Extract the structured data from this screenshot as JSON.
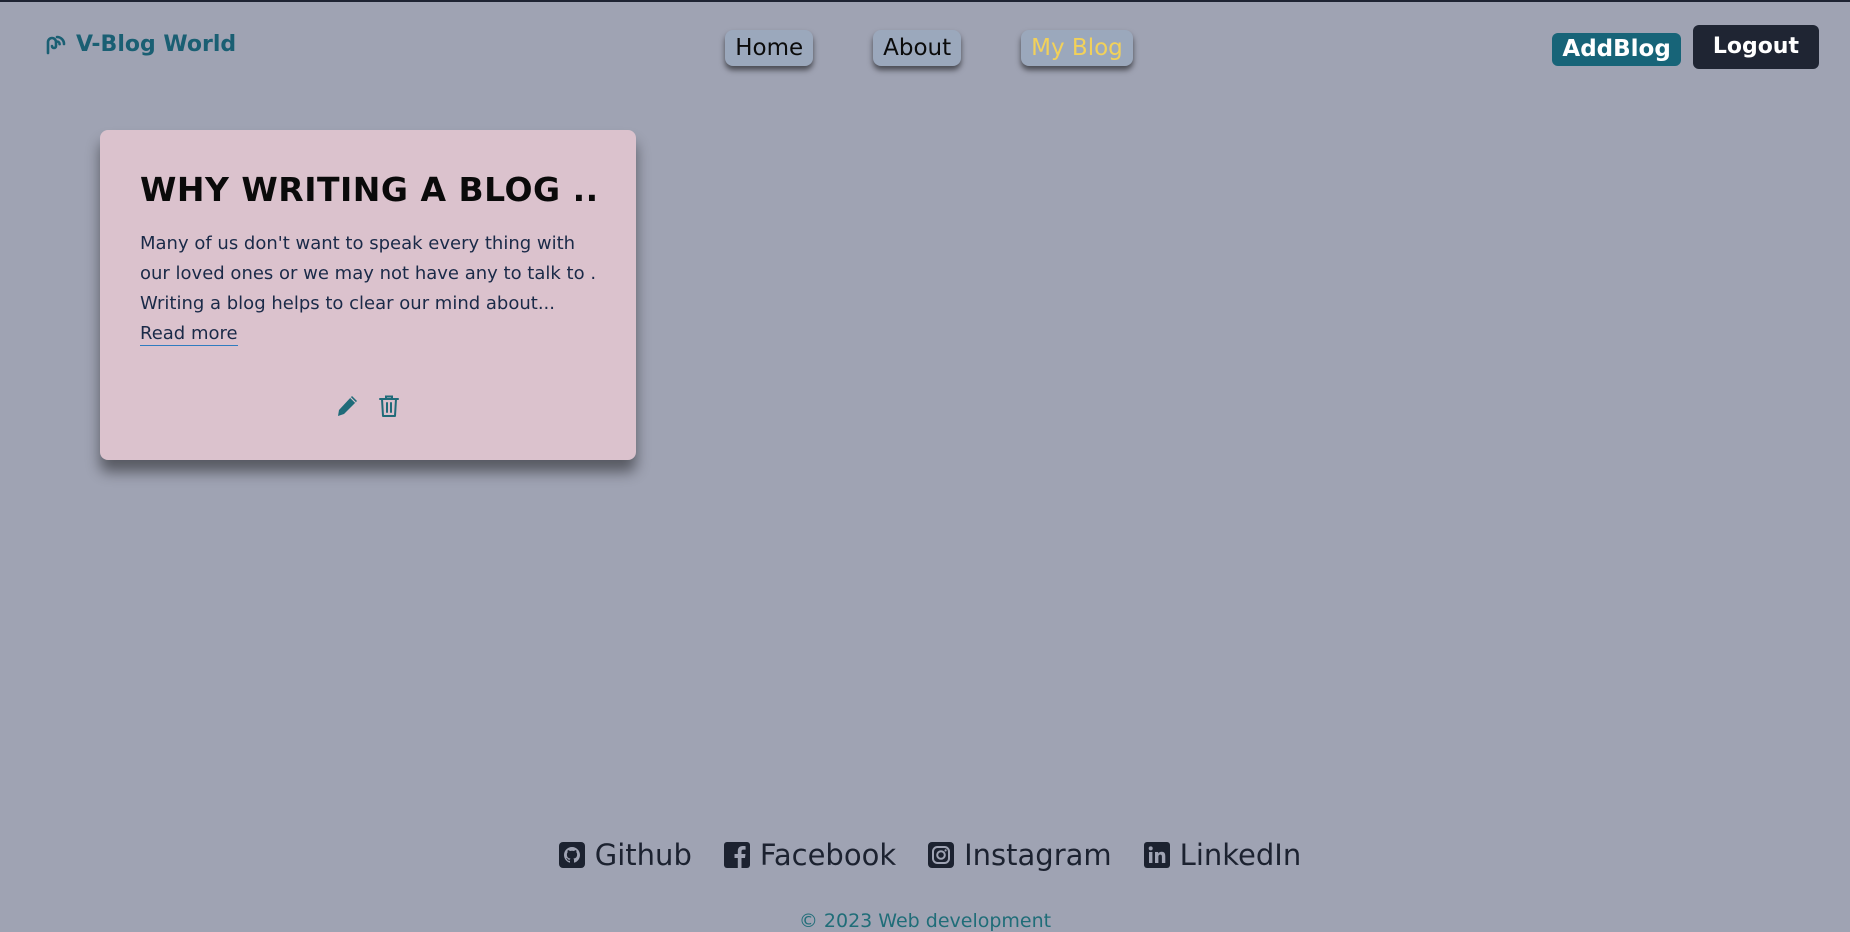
{
  "colors": {
    "background": "#9fa3b3",
    "brand": "#1a5f73",
    "active_nav": "#f2d15a",
    "addblog_bg": "#176478",
    "logout_bg": "#1f2533",
    "card_bg": "#dbc2cd"
  },
  "header": {
    "brand_icon": "rss-feed-icon",
    "brand_label": "V-Blog World",
    "nav": [
      {
        "label": "Home",
        "active": false
      },
      {
        "label": "About",
        "active": false
      },
      {
        "label": "My Blog",
        "active": true
      }
    ],
    "addblog_label": "AddBlog",
    "logout_label": "Logout"
  },
  "blog_card": {
    "title": "WHY WRITING A BLOG ...",
    "body_lines": [
      "Many of us don't want to speak every thing with",
      "our loved ones or we may not have any to talk to .",
      "Writing a blog helps to clear our mind about..."
    ],
    "read_more_label": "Read more",
    "edit_icon": "pencil-icon",
    "delete_icon": "trash-icon"
  },
  "footer": {
    "links": [
      {
        "label": "Github",
        "icon": "github-icon"
      },
      {
        "label": "Facebook",
        "icon": "facebook-icon"
      },
      {
        "label": "Instagram",
        "icon": "instagram-icon"
      },
      {
        "label": "LinkedIn",
        "icon": "linkedin-icon"
      }
    ],
    "copyright": "© 2023 Web development"
  }
}
